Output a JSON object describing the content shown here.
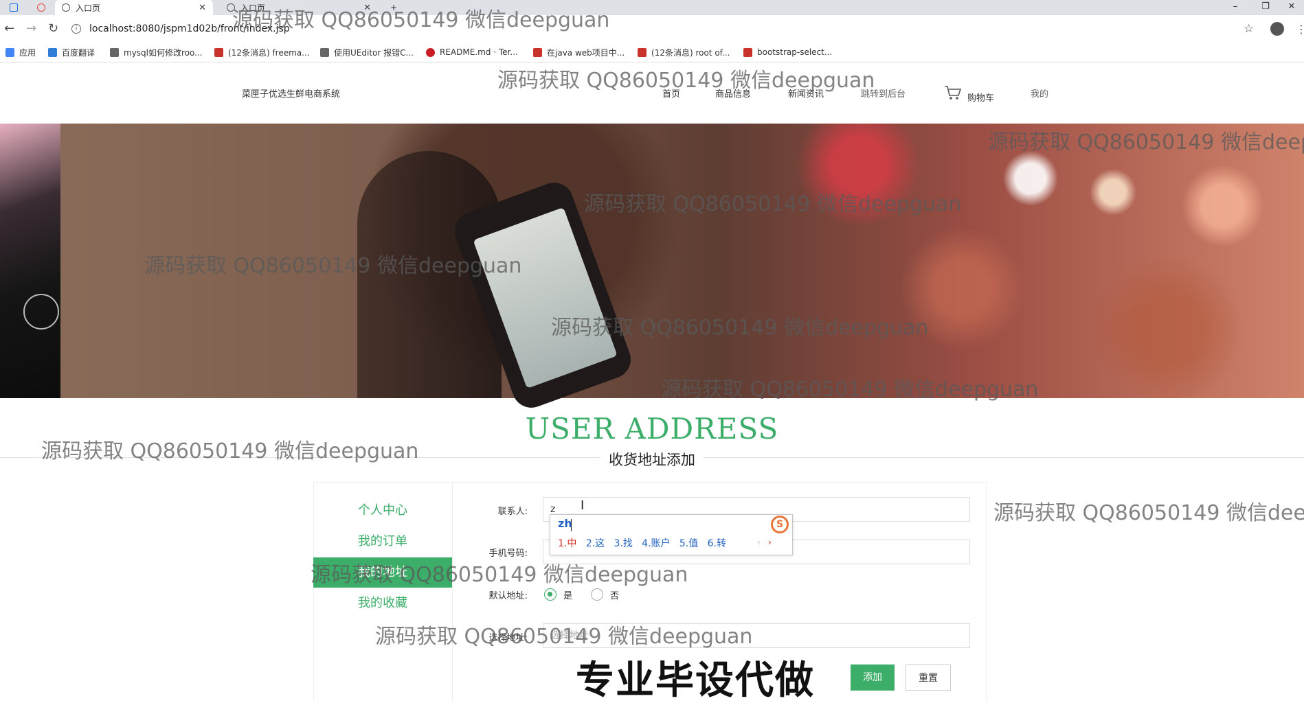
{
  "browser": {
    "tabs": [
      {
        "title": "入口页",
        "active": true
      },
      {
        "title": "入口页",
        "active": false
      }
    ],
    "new_tab": "+",
    "window_controls": {
      "minimize": "–",
      "restore": "❐",
      "close": "✕"
    },
    "url": "localhost:8080/jspm1d02b/front/index.jsp",
    "bookmarks": [
      {
        "label": "应用",
        "color": "#4285f4"
      },
      {
        "label": "百度翻译",
        "color": "#2e7dd7"
      },
      {
        "label": "mysql如何修改roo...",
        "color": "#666666"
      },
      {
        "label": "(12条消息) freema...",
        "color": "#c8342b"
      },
      {
        "label": "使用UEditor 报错C...",
        "color": "#666666"
      },
      {
        "label": "README.md · Ter...",
        "color": "#c71d23"
      },
      {
        "label": "在java web项目中...",
        "color": "#c8342b"
      },
      {
        "label": "(12条消息) root of...",
        "color": "#c8342b"
      },
      {
        "label": "bootstrap-select...",
        "color": "#c8342b"
      }
    ]
  },
  "site": {
    "title": "菜匣子优选生鲜电商系统",
    "nav": [
      "首页",
      "商品信息",
      "新闻资讯",
      "跳转到后台",
      "购物车",
      "我的"
    ]
  },
  "section": {
    "title": "USER ADDRESS",
    "subtitle": "收货地址添加"
  },
  "sidebar": {
    "items": [
      {
        "label": "个人中心",
        "active": false
      },
      {
        "label": "我的订单",
        "active": false
      },
      {
        "label": "我的地址",
        "active": true
      },
      {
        "label": "我的收藏",
        "active": false
      }
    ]
  },
  "form": {
    "contact": {
      "label": "联系人:",
      "value": "z"
    },
    "phone": {
      "label": "手机号码:",
      "placeholder": "手机号码"
    },
    "default_address": {
      "label": "默认地址:",
      "options": [
        "是",
        "否"
      ],
      "selected": "是"
    },
    "address": {
      "label": "选择地址:",
      "placeholder": "选择地址"
    },
    "submit_label": "添加",
    "reset_label": "重置"
  },
  "ime": {
    "composition": "zh",
    "candidates": [
      "1.中",
      "2.这",
      "3.找",
      "4.账户",
      "5.值",
      "6.转"
    ],
    "prev": "‹",
    "next": "›",
    "logo": "S"
  },
  "overlays": {
    "watermark": "源码获取 QQ86050149 微信deepguan",
    "stamp": "专业毕设代做"
  },
  "colors": {
    "accent": "#3cae6a",
    "ime_text": "#1f5fbf",
    "ime_first": "#d0281e"
  }
}
